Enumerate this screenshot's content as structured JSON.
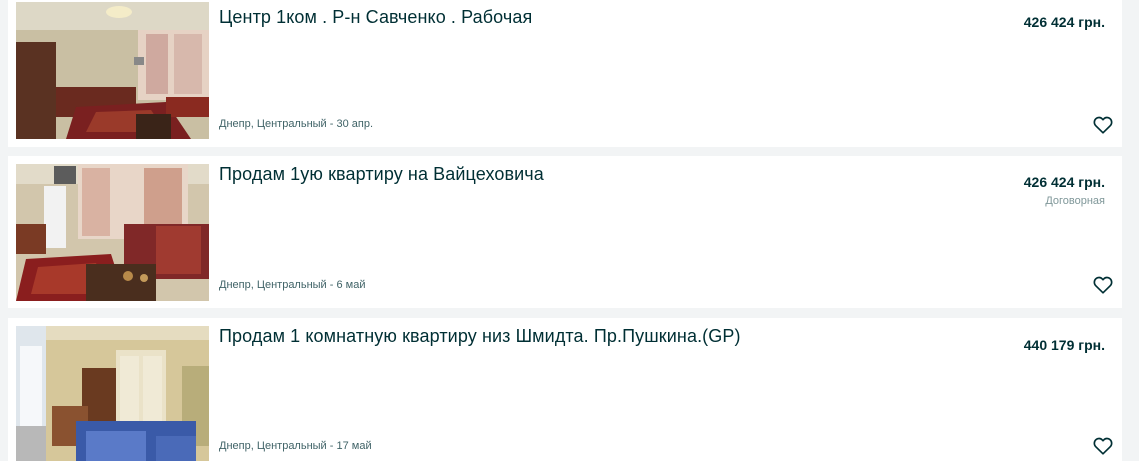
{
  "listings": [
    {
      "title": "Центр 1ком . Р-н Савченко . Рабочая",
      "price": "426 424 грн.",
      "negotiable": "",
      "location_date": "Днепр, Центральный - 30 апр.",
      "favorite_icon": "heart-icon"
    },
    {
      "title": "Продам 1ую квартиру на Вайцеховича",
      "price": "426 424 грн.",
      "negotiable": "Договорная",
      "location_date": "Днепр, Центральный - 6 май",
      "favorite_icon": "heart-icon"
    },
    {
      "title": "Продам 1 комнатную квартиру низ Шмидта. Пр.Пушкина.(GP)",
      "price": "440 179 грн.",
      "negotiable": "",
      "location_date": "Днепр, Центральный - 17 май",
      "favorite_icon": "heart-icon"
    }
  ],
  "colors": {
    "text": "#002f34",
    "meta": "#406367",
    "muted": "#7f9799",
    "background": "#f2f4f5",
    "card": "#ffffff"
  }
}
